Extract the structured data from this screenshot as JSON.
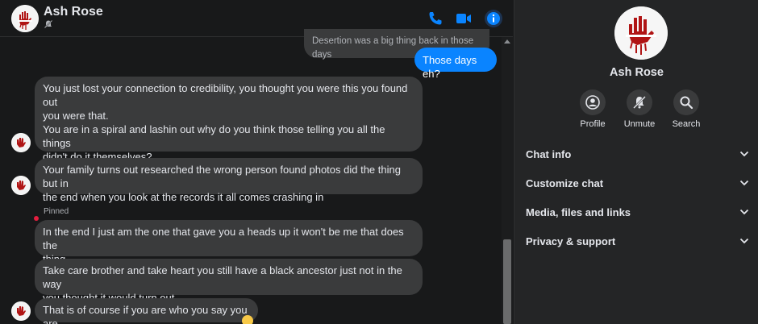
{
  "header": {
    "contact_name": "Ash Rose",
    "icons": [
      "muted-icon",
      "phone-icon",
      "video-icon",
      "info-icon"
    ],
    "accent_color": "#0a84ff"
  },
  "messages": {
    "faded_prev": "Desertion was a big thing back in those days",
    "mine_1": "Those days eh?",
    "m1": "You just lost your connection to credibility, you thought you were this you found out\nyou were that.\nYou are in a spiral and lashin out why do you think those telling you all the things\ndidn't do it themselves?\nThey have had decades to do so but never did",
    "m2": "Your family turns out researched the wrong person found photos did the thing but in\nthe end when you look at the records it all comes crashing in",
    "pinned_label": "Pinned",
    "m3": "In the end I just am the one that gave you a heads up it won't be me that does the\nthing",
    "m4": "Take care brother and take heart you still have a black ancestor just not in the way\nyou thought it would turn out",
    "m5": "That is of course if you are who you say you are"
  },
  "panel": {
    "contact_name": "Ash Rose",
    "actions": [
      {
        "label": "Profile",
        "icon": "profile-icon"
      },
      {
        "label": "Unmute",
        "icon": "unmute-icon"
      },
      {
        "label": "Search",
        "icon": "search-icon"
      }
    ],
    "sections": [
      {
        "title": "Chat info"
      },
      {
        "title": "Customize chat"
      },
      {
        "title": "Media, files and links"
      },
      {
        "title": "Privacy & support"
      }
    ]
  }
}
